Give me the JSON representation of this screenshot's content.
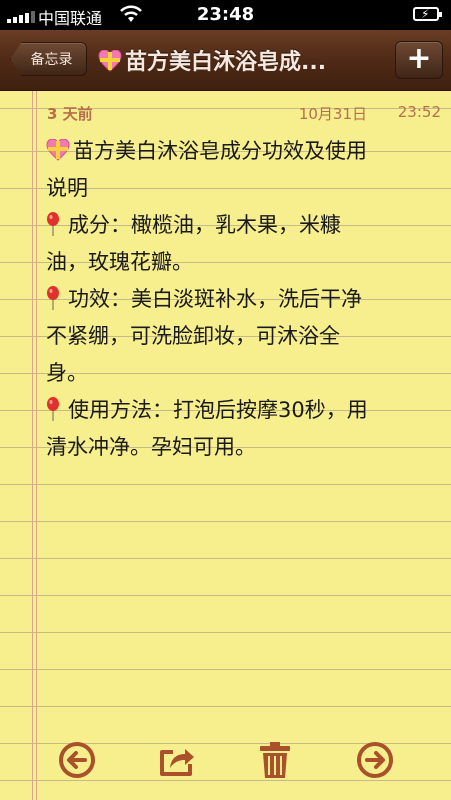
{
  "status": {
    "carrier": "中国联通",
    "time": "23:48"
  },
  "nav": {
    "back_label": "备忘录",
    "title": "苗方美白沐浴皂成...",
    "add_label": "+"
  },
  "note": {
    "relative_date": "3 天前",
    "date": "10月31日",
    "time": "23:52",
    "lines": [
      "苗方美白沐浴皂成分功效及使用",
      "说明",
      "成分：橄榄油，乳木果，米糠",
      "油，玫瑰花瓣。",
      "功效：美白淡斑补水，洗后干净",
      "不紧绷，可洗脸卸妆，可沐浴全",
      "身。",
      "使用方法：打泡后按摩30秒，用",
      "清水冲净。孕妇可用。"
    ]
  },
  "icons": {
    "title_emoji": "gift-heart-icon",
    "bullet_emoji": "balloon-icon",
    "toolbar": [
      "previous-icon",
      "share-icon",
      "trash-icon",
      "next-icon"
    ]
  },
  "colors": {
    "paper": "#f7ee8d",
    "toolbar_icon": "#a8512a",
    "meta_text": "#b5704a",
    "nav_leather": "#4f2a16"
  }
}
